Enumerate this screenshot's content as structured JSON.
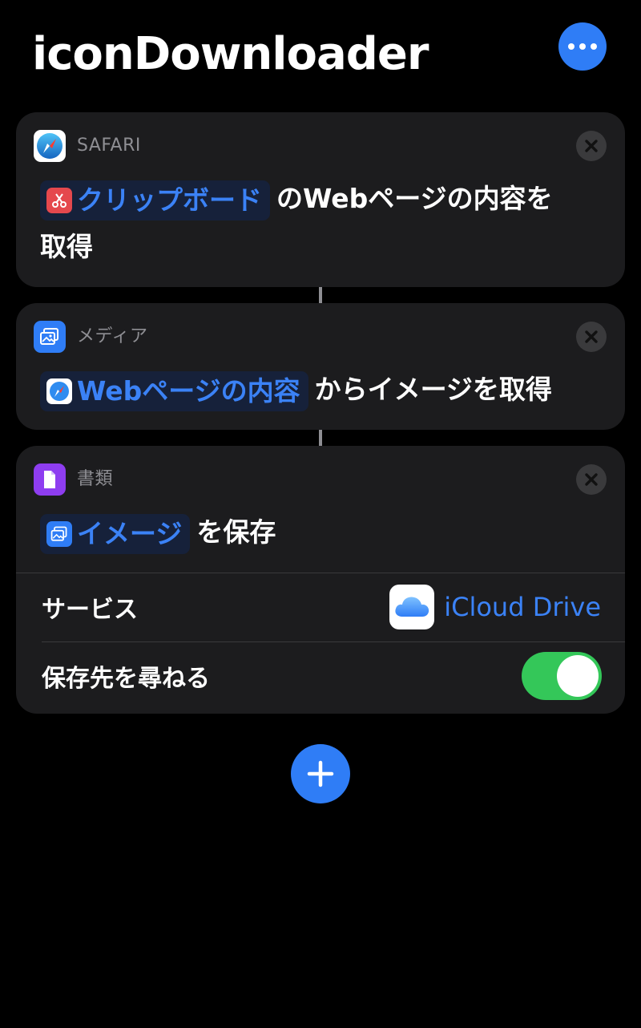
{
  "header": {
    "title": "iconDownloader"
  },
  "icons": {
    "more": "ellipsis-icon",
    "close": "close-icon",
    "add": "plus-icon"
  },
  "colors": {
    "accent": "#2f7df6",
    "token_text": "#3b82f6",
    "toggle_on": "#34c759",
    "card_bg": "#1c1c1e"
  },
  "actions": [
    {
      "app_label": "SAFARI",
      "app_icon": "safari-compass-icon",
      "token": {
        "icon": "scissors-icon",
        "label": "クリップボード"
      },
      "text_after": "のWebページの内容を",
      "text_line2": "取得"
    },
    {
      "app_label": "メディア",
      "app_icon": "photos-icon",
      "token": {
        "icon": "safari-compass-icon",
        "label": "Webページの内容"
      },
      "text_after": "からイメージを取得"
    },
    {
      "app_label": "書類",
      "app_icon": "document-icon",
      "token": {
        "icon": "photos-icon",
        "label": "イメージ"
      },
      "text_after": "を保存",
      "rows": {
        "service_label": "サービス",
        "service_value": "iCloud Drive",
        "service_icon": "icloud-icon",
        "ask_label": "保存先を尋ねる",
        "ask_enabled": true
      }
    }
  ]
}
